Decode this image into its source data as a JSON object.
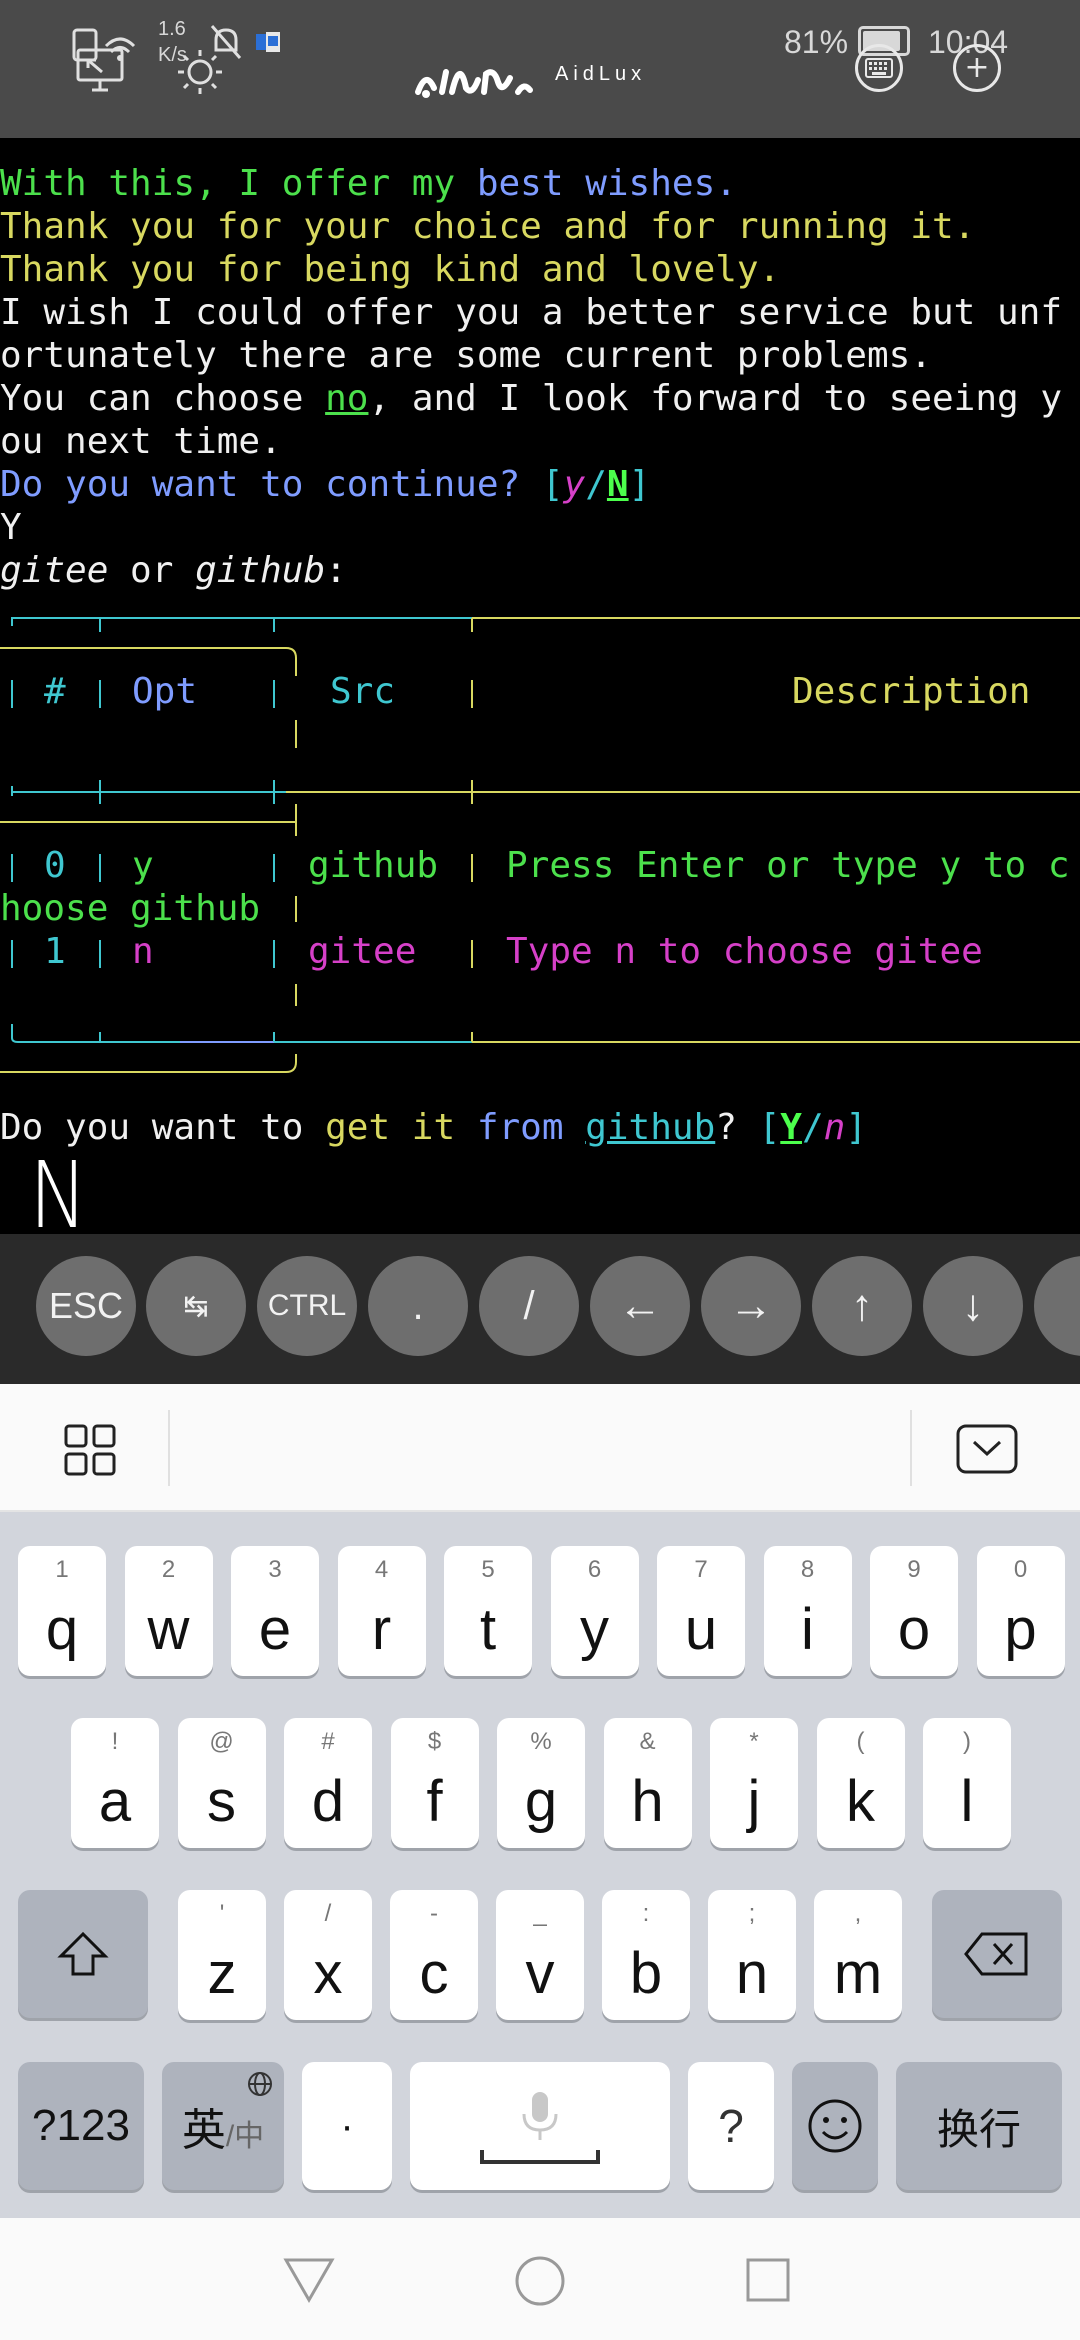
{
  "status_bar": {
    "net_speed_value": "1.6",
    "net_speed_unit": "K/s",
    "app_name": "AidLux",
    "battery": "81%",
    "time": "10:04"
  },
  "terminal": {
    "line1_a": "With this, I offer my ",
    "line1_b": "best wishes.",
    "line2": "Thank you for your choice and for running it.",
    "line3": "Thank you for being kind and lovely.",
    "line4": "I wish I could offer you a better service but unf",
    "line5": "ortunately there are some current problems.",
    "line6_a": "You can choose ",
    "line6_b": "no",
    "line6_c": ", and I look forward to seeing y",
    "line7": "ou next time.",
    "line8_a": "Do you want to continue? ",
    "line8_b": "[",
    "line8_c": "y",
    "line8_d": "/",
    "line8_e": "N",
    "line8_f": "]",
    "line9": "Y",
    "line10_a": "gitee",
    "line10_b": " or ",
    "line10_c": "github",
    "line10_d": ":",
    "table": {
      "headers": {
        "num": "#",
        "opt": "Opt",
        "src": "Src",
        "desc": "Description"
      },
      "rows": [
        {
          "num": "0",
          "opt": "y",
          "src": "github",
          "desc": "Press Enter or type y to c",
          "desc_wrap": "hoose github"
        },
        {
          "num": "1",
          "opt": "n",
          "src": "gitee",
          "desc": "Type n to choose gitee"
        }
      ]
    },
    "prompt_a": "Do you want to ",
    "prompt_b": "get it ",
    "prompt_c": "from ",
    "prompt_d": "github",
    "prompt_e": "? ",
    "prompt_f": "[",
    "prompt_g": "Y",
    "prompt_h": "/",
    "prompt_i": "n",
    "prompt_j": "]",
    "handwritten_input": "N"
  },
  "extra_keys": [
    "ESC",
    "↹",
    "CTRL",
    ".",
    "/",
    "←",
    "→",
    "↑",
    "↓"
  ],
  "keyboard": {
    "row1": [
      {
        "hint": "1",
        "key": "q"
      },
      {
        "hint": "2",
        "key": "w"
      },
      {
        "hint": "3",
        "key": "e"
      },
      {
        "hint": "4",
        "key": "r"
      },
      {
        "hint": "5",
        "key": "t"
      },
      {
        "hint": "6",
        "key": "y"
      },
      {
        "hint": "7",
        "key": "u"
      },
      {
        "hint": "8",
        "key": "i"
      },
      {
        "hint": "9",
        "key": "o"
      },
      {
        "hint": "0",
        "key": "p"
      }
    ],
    "row2": [
      {
        "hint": "!",
        "key": "a"
      },
      {
        "hint": "@",
        "key": "s"
      },
      {
        "hint": "#",
        "key": "d"
      },
      {
        "hint": "$",
        "key": "f"
      },
      {
        "hint": "%",
        "key": "g"
      },
      {
        "hint": "&",
        "key": "h"
      },
      {
        "hint": "*",
        "key": "j"
      },
      {
        "hint": "(",
        "key": "k"
      },
      {
        "hint": ")",
        "key": "l"
      }
    ],
    "row3": [
      {
        "hint": "'",
        "key": "z"
      },
      {
        "hint": "/",
        "key": "x"
      },
      {
        "hint": "-",
        "key": "c"
      },
      {
        "hint": "_",
        "key": "v"
      },
      {
        "hint": ":",
        "key": "b"
      },
      {
        "hint": ";",
        "key": "n"
      },
      {
        "hint": ",",
        "key": "m"
      }
    ],
    "symbols_key": "?123",
    "lang_key_main": "英",
    "lang_key_sub": "/中",
    "dot_key": "·",
    "question_key": "?",
    "enter_key": "换行"
  }
}
